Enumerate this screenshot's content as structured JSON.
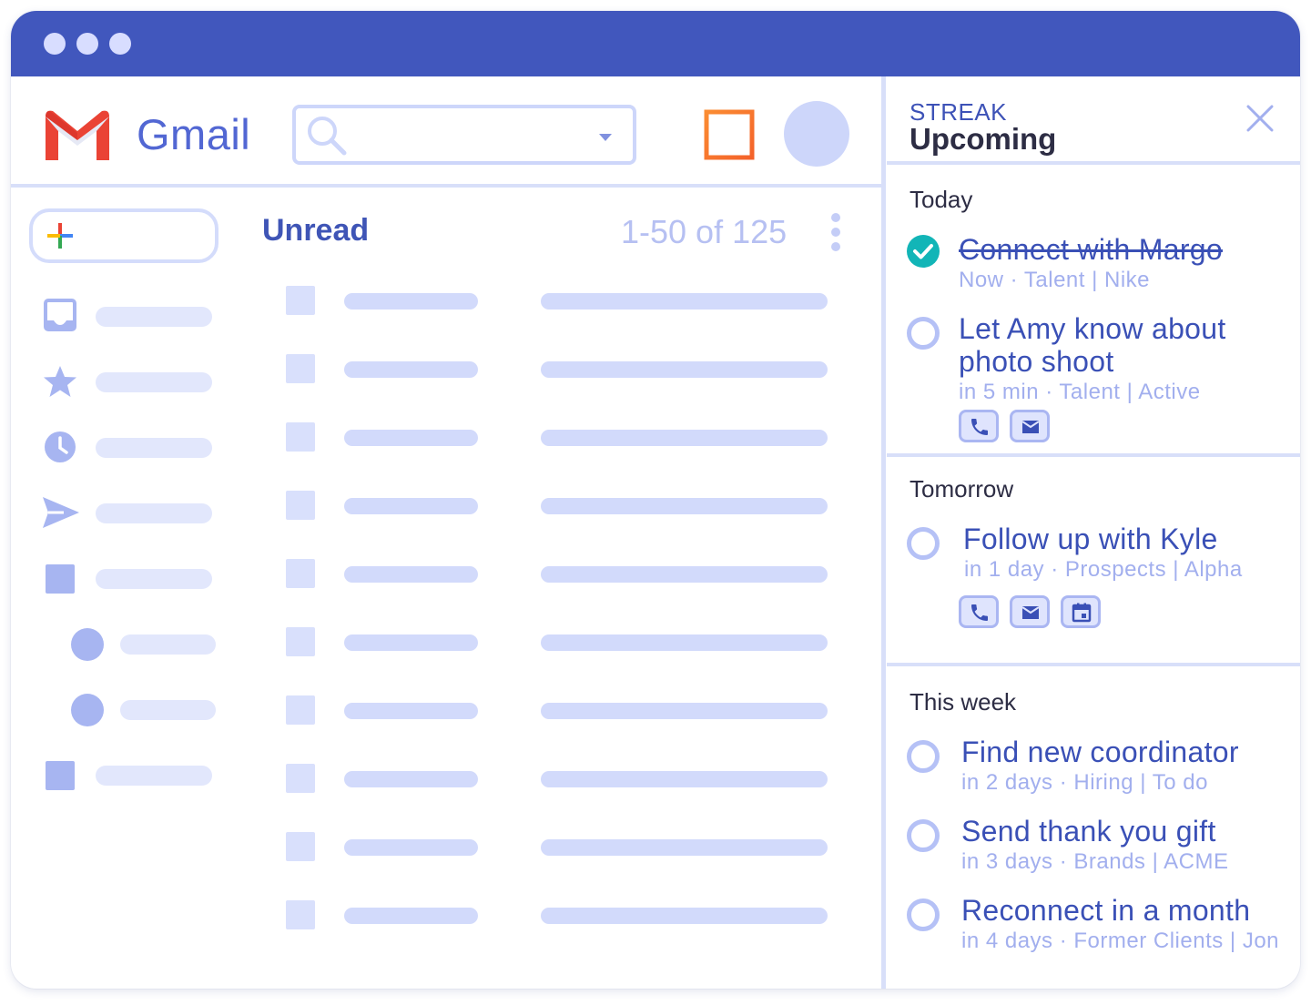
{
  "gmail": {
    "brand": "Gmail",
    "list_title": "Unread",
    "list_count": "1-50 of 125"
  },
  "icons": {
    "logo": "gmail-m-logo",
    "search": "search-icon",
    "dropdown": "caret-down-icon",
    "layout": "layout-grid-icon",
    "compose": "plus-icon",
    "more": "more-vertical-icon",
    "nav": [
      "inbox-icon",
      "star-icon",
      "clock-icon",
      "send-icon",
      "square-icon",
      "circle-icon",
      "circle-icon",
      "square-icon"
    ],
    "close": "close-icon",
    "phone": "phone-icon",
    "mail": "mail-icon",
    "calendar": "calendar-icon",
    "check": "check-circle-icon"
  },
  "streak": {
    "label": "STREAK",
    "title": "Upcoming",
    "sections": [
      {
        "heading": "Today",
        "tasks": [
          {
            "title": "Connect with Margo",
            "meta": "Now · Talent | Nike",
            "done": true
          },
          {
            "title_lines": [
              "Let Amy know about",
              "photo shoot"
            ],
            "meta": "in 5 min · Talent | Active",
            "done": false,
            "actions": [
              "phone",
              "mail"
            ]
          }
        ]
      },
      {
        "heading": "Tomorrow",
        "tasks": [
          {
            "title": "Follow up with Kyle",
            "meta": "in 1 day · Prospects | Alpha",
            "done": false,
            "actions": [
              "phone",
              "mail",
              "calendar"
            ]
          }
        ]
      },
      {
        "heading": "This week",
        "tasks": [
          {
            "title": "Find new coordinator",
            "meta": "in 2 days · Hiring | To do",
            "done": false
          },
          {
            "title": "Send thank you gift",
            "meta": "in 3 days · Brands | ACME",
            "done": false
          },
          {
            "title": "Reconnect in a month",
            "meta": "in 4 days · Former Clients | Jon",
            "done": false
          }
        ]
      }
    ]
  },
  "colors": {
    "titlebar": "#4157bd",
    "accent": "#3a50b6",
    "placeholder": "#d2dafb",
    "done": "#12b5b7"
  }
}
